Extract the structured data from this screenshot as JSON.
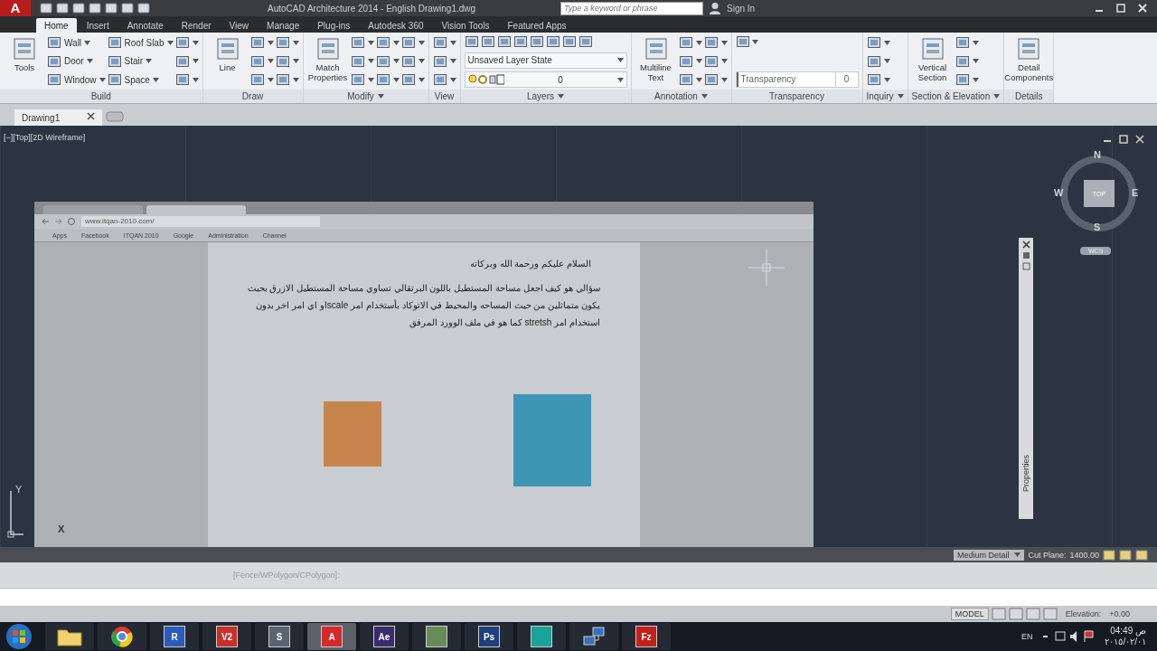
{
  "app_button": {
    "label": "A"
  },
  "window": {
    "title": "AutoCAD Architecture 2014 - English   Drawing1.dwg"
  },
  "search": {
    "placeholder": "Type a keyword or phrase"
  },
  "sign_in": "Sign In",
  "ribbon_tabs": [
    {
      "label": "Home",
      "selected": true
    },
    {
      "label": "Insert",
      "selected": false
    },
    {
      "label": "Annotate",
      "selected": false
    },
    {
      "label": "Render",
      "selected": false
    },
    {
      "label": "View",
      "selected": false
    },
    {
      "label": "Manage",
      "selected": false
    },
    {
      "label": "Plug-ins",
      "selected": false
    },
    {
      "label": "Autodesk 360",
      "selected": false
    },
    {
      "label": "Vision Tools",
      "selected": false
    },
    {
      "label": "Featured Apps",
      "selected": false
    }
  ],
  "panels": [
    {
      "title": "Build",
      "menu": false,
      "items": [
        {
          "kind": "large",
          "label": "Tools"
        },
        {
          "kind": "small",
          "label": "Wall"
        },
        {
          "kind": "small",
          "label": "Door"
        },
        {
          "kind": "small",
          "label": "Window"
        },
        {
          "kind": "small",
          "label": "Roof Slab"
        },
        {
          "kind": "small",
          "label": "Stair"
        },
        {
          "kind": "small",
          "label": "Space"
        },
        {
          "kind": "icon"
        },
        {
          "kind": "icon"
        },
        {
          "kind": "icon"
        }
      ]
    },
    {
      "title": "Draw",
      "menu": false,
      "items": [
        {
          "kind": "large",
          "label": "Line"
        },
        {
          "kind": "icon"
        },
        {
          "kind": "icon"
        },
        {
          "kind": "icon"
        },
        {
          "kind": "icon"
        },
        {
          "kind": "icon"
        },
        {
          "kind": "icon"
        }
      ]
    },
    {
      "title": "Modify",
      "menu": true,
      "items": [
        {
          "kind": "large",
          "label": "Match Properties"
        },
        {
          "kind": "icon"
        },
        {
          "kind": "icon"
        },
        {
          "kind": "icon"
        },
        {
          "kind": "icon"
        },
        {
          "kind": "icon"
        },
        {
          "kind": "icon"
        },
        {
          "kind": "icon"
        },
        {
          "kind": "icon"
        },
        {
          "kind": "icon"
        }
      ]
    },
    {
      "title": "View",
      "menu": false,
      "items": [
        {
          "kind": "icon"
        },
        {
          "kind": "icon"
        },
        {
          "kind": "icon"
        }
      ]
    },
    {
      "title": "Layers",
      "menu": true,
      "items": [
        {
          "kind": "layers"
        }
      ]
    },
    {
      "title": "Annotation",
      "menu": true,
      "items": [
        {
          "kind": "large",
          "label": "Multiline Text"
        },
        {
          "kind": "icon"
        },
        {
          "kind": "icon"
        },
        {
          "kind": "icon"
        },
        {
          "kind": "icon"
        },
        {
          "kind": "icon"
        },
        {
          "kind": "icon"
        }
      ]
    },
    {
      "title": "Transparency",
      "menu": false,
      "items": [
        {
          "kind": "transparency"
        }
      ]
    },
    {
      "title": "Inquiry",
      "menu": true,
      "items": [
        {
          "kind": "icon"
        },
        {
          "kind": "icon"
        },
        {
          "kind": "icon"
        }
      ]
    },
    {
      "title": "Section & Elevation",
      "menu": true,
      "items": [
        {
          "kind": "large",
          "label": "Vertical Section"
        },
        {
          "kind": "icon"
        },
        {
          "kind": "icon"
        },
        {
          "kind": "icon"
        }
      ]
    },
    {
      "title": "Details",
      "menu": false,
      "items": [
        {
          "kind": "large",
          "label": "Detail Components"
        }
      ]
    }
  ],
  "layers": {
    "state": "Unsaved Layer State",
    "current": "0"
  },
  "transparency": {
    "label": "Transparency",
    "value": "0"
  },
  "doc_tabs": [
    {
      "label": "Drawing1",
      "selected": true
    }
  ],
  "viewport": {
    "label": "[−][Top][2D Wireframe]"
  },
  "viewcube": {
    "north": "N",
    "south": "S",
    "east": "E",
    "west": "W",
    "face": "TOP",
    "ucs": "WCS"
  },
  "ucs_axes": {
    "y": "Y",
    "x": "X"
  },
  "palette": {
    "title": "Properties"
  },
  "browser": {
    "address": "www.itqan-2010.com/",
    "bookmarks": [
      "Apps",
      "Facebook",
      "ITQAN 2010",
      "Google",
      "Administration",
      "Channel"
    ],
    "greeting": "السلام عليكم ورحمة الله وبركاته",
    "question": "سؤالي هو كيف اجعل مساحة المستطيل باللون البرتقالي تساوي مساحة المستطيل الازرق بحيث يكون متماثلين من حيث المساحه والمحيط في الاتوكاد بأستخدام امر scaleاو اي امر اخر بدون استخدام امر stretsh كما هو في ملف الوورد المرفق",
    "shapes": [
      {
        "color": "#d08a4e"
      },
      {
        "color": "#3e9dbb"
      }
    ]
  },
  "drawing_status": {
    "detail": "Medium Detail",
    "cut_plane_label": "Cut Plane:",
    "cut_plane": "1400.00"
  },
  "command_line": "[Fence/WPolygon/CPolygon]:",
  "status_bar": {
    "mode": "MODEL",
    "elevation_label": "Elevation:",
    "elevation": "+0.00"
  },
  "taskbar": [
    {
      "kind": "start"
    },
    {
      "kind": "folder"
    },
    {
      "kind": "browser"
    },
    {
      "kind": "app",
      "label": "R",
      "color": "#2a5bb8",
      "selected": false
    },
    {
      "kind": "app",
      "label": "V2",
      "color": "#c8302c",
      "selected": false
    },
    {
      "kind": "app",
      "label": "S",
      "color": "#5a6470",
      "selected": false
    },
    {
      "kind": "app",
      "label": "A",
      "color": "#d42a2a",
      "selected": true
    },
    {
      "kind": "app",
      "label": "Ae",
      "color": "#3a2a6e",
      "selected": false
    },
    {
      "kind": "app",
      "color": "#6a8a5a",
      "selected": false
    },
    {
      "kind": "app",
      "label": "Ps",
      "color": "#1f3f7a",
      "selected": false
    },
    {
      "kind": "app",
      "color": "#1aa39a",
      "selected": false
    },
    {
      "kind": "network"
    },
    {
      "kind": "app",
      "label": "Fz",
      "color": "#c4201c",
      "selected": false
    }
  ],
  "tray": {
    "language": "EN",
    "time": "04:49 ص",
    "date": "٢٠١٥/٠٢/٠١"
  }
}
